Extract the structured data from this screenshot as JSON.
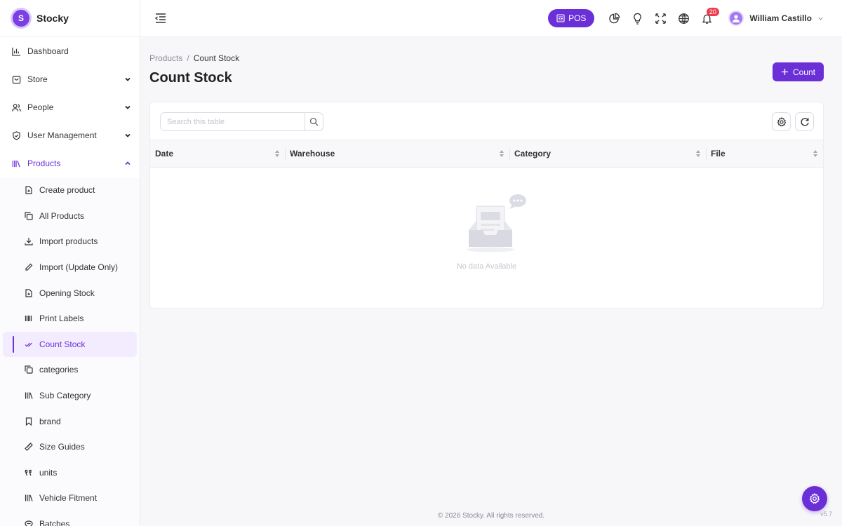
{
  "brand": {
    "name": "Stocky",
    "logo_letter": "S",
    "accent": "#6b2fd8"
  },
  "sidebar": {
    "items": [
      {
        "label": "Dashboard",
        "icon": "bar-chart-icon"
      },
      {
        "label": "Store",
        "icon": "store-icon"
      },
      {
        "label": "People",
        "icon": "people-icon"
      },
      {
        "label": "User Management",
        "icon": "shield-icon"
      },
      {
        "label": "Products",
        "icon": "products-icon"
      }
    ],
    "products_sub": [
      {
        "label": "Create product",
        "icon": "file-plus-icon"
      },
      {
        "label": "All Products",
        "icon": "copy-icon"
      },
      {
        "label": "Import products",
        "icon": "download-icon"
      },
      {
        "label": "Import (Update Only)",
        "icon": "pencil-icon"
      },
      {
        "label": "Opening Stock",
        "icon": "file-plus-icon"
      },
      {
        "label": "Print Labels",
        "icon": "barcode-icon"
      },
      {
        "label": "Count Stock",
        "icon": "check-double-icon"
      },
      {
        "label": "categories",
        "icon": "copy-icon"
      },
      {
        "label": "Sub Category",
        "icon": "books-icon"
      },
      {
        "label": "brand",
        "icon": "bookmark-icon"
      },
      {
        "label": "Size Guides",
        "icon": "ruler-icon"
      },
      {
        "label": "units",
        "icon": "units-icon"
      },
      {
        "label": "Vehicle Fitment",
        "icon": "books-icon"
      },
      {
        "label": "Batches",
        "icon": "batches-icon"
      }
    ]
  },
  "topbar": {
    "pos_label": "POS",
    "notifications_count": "20",
    "user_name": "William Castillo"
  },
  "breadcrumb": {
    "parent": "Products",
    "separator": "/",
    "current": "Count Stock"
  },
  "page": {
    "title": "Count Stock",
    "count_button": "Count"
  },
  "table": {
    "search_placeholder": "Search this table",
    "columns": [
      "Date",
      "Warehouse",
      "Category",
      "File"
    ],
    "empty_text": "No data Available"
  },
  "footer": {
    "copyright": "© 2026 Stocky. All rights reserved.",
    "version": "v5.7"
  }
}
